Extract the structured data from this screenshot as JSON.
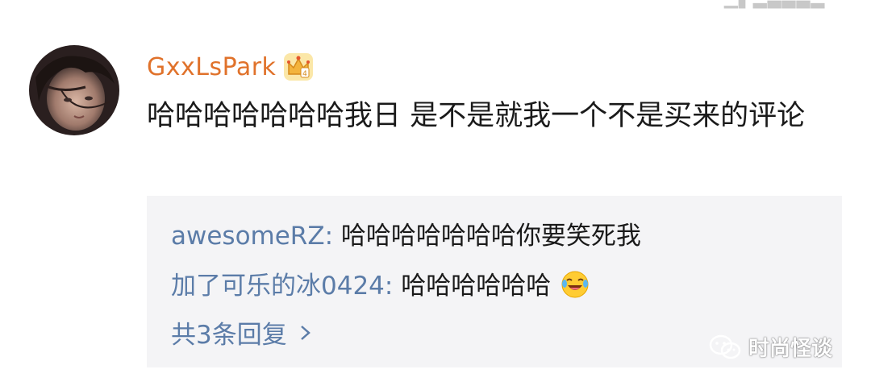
{
  "comment": {
    "username": "GxxLsPark",
    "text": "哈哈哈哈哈哈哈我日 是不是就我一个不是买来的评论"
  },
  "replies": [
    {
      "author": "awesomeRZ:",
      "text": "哈哈哈哈哈哈哈你要笑死我"
    },
    {
      "author": "加了可乐的冰0424:",
      "text": "哈哈哈哈哈哈"
    }
  ],
  "more_replies_label": "共3条回复",
  "watermark": "时尚怪谈",
  "icons": [
    "avatar",
    "crown-icon",
    "laughing-emoji-icon",
    "chevron-right-icon",
    "wechat-icon"
  ],
  "colors": {
    "username": "#e0722b",
    "reply_author": "#5b7ca8",
    "reply_box_bg": "#f4f4f6",
    "text": "#1a1a1a"
  }
}
